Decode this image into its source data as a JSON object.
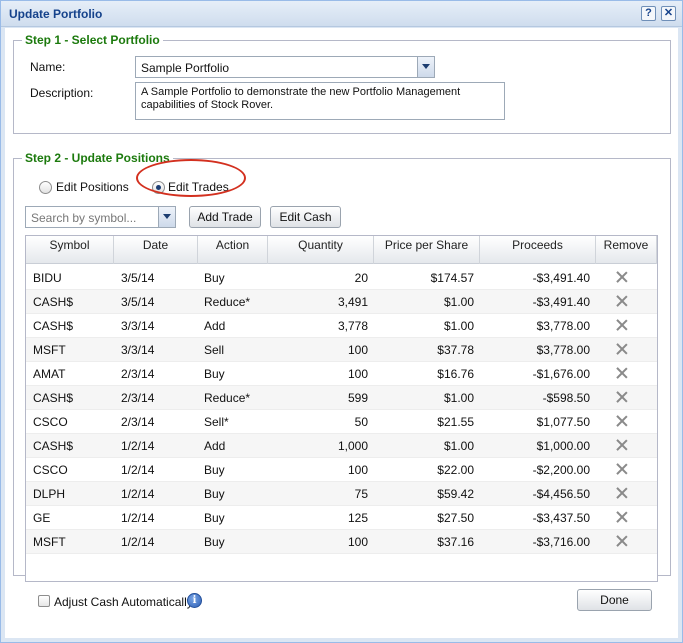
{
  "window": {
    "title": "Update Portfolio",
    "help_glyph": "?",
    "close_glyph": "✕"
  },
  "step1": {
    "legend": "Step 1 - Select Portfolio",
    "name_label": "Name:",
    "name_value": "Sample Portfolio",
    "description_label": "Description:",
    "description_value": "A Sample Portfolio to demonstrate the new Portfolio Management capabilities of Stock Rover."
  },
  "step2": {
    "legend": "Step 2 - Update Positions",
    "radio_positions": "Edit Positions",
    "radio_trades": "Edit Trades",
    "selected_mode": "Edit Trades",
    "search_placeholder": "Search by symbol...",
    "add_trade_label": "Add Trade",
    "edit_cash_label": "Edit Cash"
  },
  "grid": {
    "columns": [
      "Symbol",
      "Date",
      "Action",
      "Quantity",
      "Price per Share",
      "Proceeds",
      "Remove"
    ],
    "rows": [
      {
        "symbol": "BIDU",
        "date": "3/5/14",
        "action": "Buy",
        "quantity": "20",
        "price": "$174.57",
        "proceeds": "-$3,491.40"
      },
      {
        "symbol": "CASH$",
        "date": "3/5/14",
        "action": "Reduce*",
        "quantity": "3,491",
        "price": "$1.00",
        "proceeds": "-$3,491.40"
      },
      {
        "symbol": "CASH$",
        "date": "3/3/14",
        "action": "Add",
        "quantity": "3,778",
        "price": "$1.00",
        "proceeds": "$3,778.00"
      },
      {
        "symbol": "MSFT",
        "date": "3/3/14",
        "action": "Sell",
        "quantity": "100",
        "price": "$37.78",
        "proceeds": "$3,778.00"
      },
      {
        "symbol": "AMAT",
        "date": "2/3/14",
        "action": "Buy",
        "quantity": "100",
        "price": "$16.76",
        "proceeds": "-$1,676.00"
      },
      {
        "symbol": "CASH$",
        "date": "2/3/14",
        "action": "Reduce*",
        "quantity": "599",
        "price": "$1.00",
        "proceeds": "-$598.50"
      },
      {
        "symbol": "CSCO",
        "date": "2/3/14",
        "action": "Sell*",
        "quantity": "50",
        "price": "$21.55",
        "proceeds": "$1,077.50"
      },
      {
        "symbol": "CASH$",
        "date": "1/2/14",
        "action": "Add",
        "quantity": "1,000",
        "price": "$1.00",
        "proceeds": "$1,000.00"
      },
      {
        "symbol": "CSCO",
        "date": "1/2/14",
        "action": "Buy",
        "quantity": "100",
        "price": "$22.00",
        "proceeds": "-$2,200.00"
      },
      {
        "symbol": "DLPH",
        "date": "1/2/14",
        "action": "Buy",
        "quantity": "75",
        "price": "$59.42",
        "proceeds": "-$4,456.50"
      },
      {
        "symbol": "GE",
        "date": "1/2/14",
        "action": "Buy",
        "quantity": "125",
        "price": "$27.50",
        "proceeds": "-$3,437.50"
      },
      {
        "symbol": "MSFT",
        "date": "1/2/14",
        "action": "Buy",
        "quantity": "100",
        "price": "$37.16",
        "proceeds": "-$3,716.00"
      }
    ]
  },
  "footer": {
    "adjust_cash_label": "Adjust Cash Automatically",
    "adjust_cash_checked": false,
    "info_glyph": "i",
    "done_label": "Done"
  },
  "colors": {
    "legend_green": "#1c7a0d",
    "title_blue": "#15428b",
    "annotation_red": "#d3301f"
  },
  "icons": {
    "remove": "x-icon",
    "info": "info-icon",
    "dropdown": "chevron-down-icon",
    "help": "help-icon",
    "close": "close-icon"
  }
}
